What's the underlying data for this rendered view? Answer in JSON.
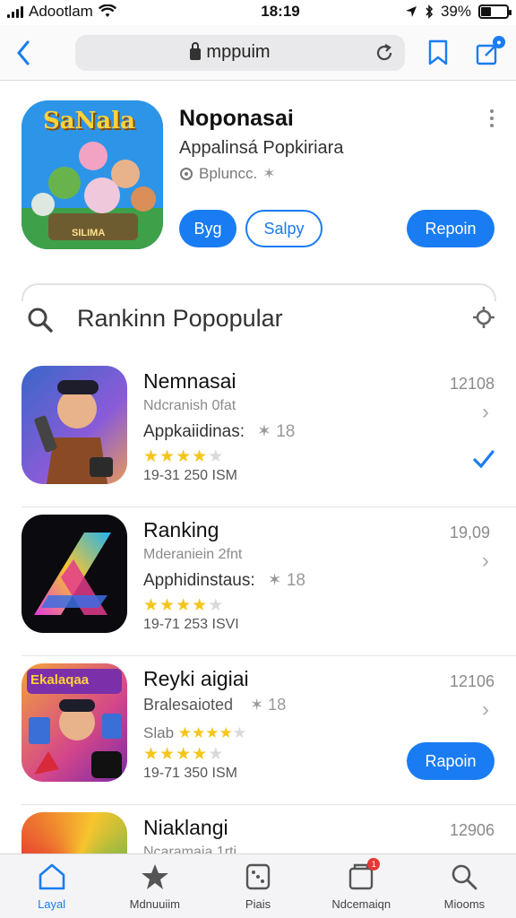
{
  "status_bar": {
    "carrier": "Adootlam",
    "time": "18:19",
    "battery_pct": "39%",
    "battery_level": 0.39
  },
  "toolbar": {
    "url": "mppuim"
  },
  "featured": {
    "icon_label": "SaNala",
    "icon_sublabel": "SILIMA",
    "title": "Noponasai",
    "subtitle": "Appalinsá Popkiriara",
    "meta": "Bpluncc.",
    "btn_left": "Byg",
    "btn_middle": "Salpy",
    "btn_right": "Repoin"
  },
  "ranking": {
    "title": "Rankinn Popopular"
  },
  "items": [
    {
      "name": "Nemnasai",
      "developer": "Ndcranish 0fat",
      "category": "Appkaiidinas:",
      "rating": "✶ 18",
      "stars": 4,
      "size": "19-31 250 ISM",
      "number": "12108"
    },
    {
      "name": "Ranking",
      "developer": "Mderaniein 2fnt",
      "category": "Apphidinstaus:",
      "rating": "✶ 18",
      "stars": 4,
      "size": "19-71 253 ISVI",
      "number": "19,09"
    },
    {
      "name": "Reyki aigiai",
      "developer": "Bralesaioted",
      "category": "Slab",
      "rating": "✶ 18",
      "stars": 4,
      "size": "19-71 350 ISM",
      "number": "12106",
      "button": "Rapoin",
      "icon_label": "Ekalaqaa"
    },
    {
      "name": "Niaklangi",
      "developer": "Ncaramaia 1rti",
      "number": "12906"
    }
  ],
  "tabs": [
    {
      "label": "Layal",
      "icon": "house-icon"
    },
    {
      "label": "Mdnuuiim",
      "icon": "star-icon"
    },
    {
      "label": "Piais",
      "icon": "dice-icon"
    },
    {
      "label": "Ndcemaiqn",
      "icon": "inbox-icon",
      "badge": "1"
    },
    {
      "label": "Miooms",
      "icon": "search-icon"
    }
  ],
  "colors": {
    "accent": "#1a7cf2",
    "star": "#f5c518",
    "badge": "#e53935"
  }
}
